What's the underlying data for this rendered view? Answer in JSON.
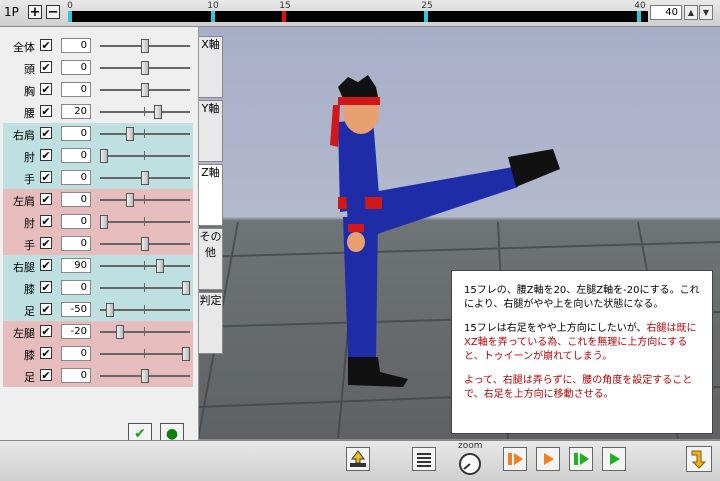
{
  "topbar": {
    "player_label": "1P",
    "plus_label": "+",
    "minus_label": "−",
    "tick_labels": [
      "0",
      "10",
      "15",
      "25",
      "40"
    ],
    "frame_value": "40",
    "spin_up": "▲",
    "spin_down": "▼"
  },
  "joints": [
    {
      "label": "全体",
      "value": "0",
      "checked": "✔",
      "group": "none",
      "level": 0.5
    },
    {
      "label": "頭",
      "value": "0",
      "checked": "✔",
      "group": "none",
      "level": 0.5
    },
    {
      "label": "胸",
      "value": "0",
      "checked": "✔",
      "group": "none",
      "level": 0.5
    },
    {
      "label": "腰",
      "value": "20",
      "checked": "✔",
      "group": "none",
      "level": 0.66
    },
    {
      "label": "右肩",
      "value": "0",
      "checked": "✔",
      "group": "blue",
      "level": 0.32
    },
    {
      "label": "肘",
      "value": "0",
      "checked": "✔",
      "group": "blue",
      "level": 0.0
    },
    {
      "label": "手",
      "value": "0",
      "checked": "✔",
      "group": "blue",
      "level": 0.5
    },
    {
      "label": "左肩",
      "value": "0",
      "checked": "✔",
      "group": "red",
      "level": 0.32
    },
    {
      "label": "肘",
      "value": "0",
      "checked": "✔",
      "group": "red",
      "level": 0.0
    },
    {
      "label": "手",
      "value": "0",
      "checked": "✔",
      "group": "red",
      "level": 0.5
    },
    {
      "label": "右腿",
      "value": "90",
      "checked": "✔",
      "group": "blue",
      "level": 0.68
    },
    {
      "label": "膝",
      "value": "0",
      "checked": "✔",
      "group": "blue",
      "level": 1.0
    },
    {
      "label": "足",
      "value": "-50",
      "checked": "✔",
      "group": "blue",
      "level": 0.07
    },
    {
      "label": "左腿",
      "value": "-20",
      "checked": "✔",
      "group": "red",
      "level": 0.2
    },
    {
      "label": "膝",
      "value": "0",
      "checked": "✔",
      "group": "red",
      "level": 1.0
    },
    {
      "label": "足",
      "value": "0",
      "checked": "✔",
      "group": "red",
      "level": 0.5
    }
  ],
  "side_tabs": [
    {
      "label": "X軸"
    },
    {
      "label": "Y軸"
    },
    {
      "label": "Z軸"
    },
    {
      "label": "その他"
    },
    {
      "label": "判定"
    }
  ],
  "panel_buttons": {
    "confirm_glyph": "✔",
    "dot_glyph": "●"
  },
  "info": {
    "p1": "15フレの、腰Z軸を20、左腿Z軸を-20にする。これにより、右腿がやや上を向いた状態になる。",
    "p2_black": "15フレは右足をやや上方向にしたいが、",
    "p2_red": "右腿は既にXZ軸を弄っている為、これを無理に上方向にすると、トゥイーンが崩れてしまう。",
    "p3": "よって、右腿は弄らずに、腰の角度を設定することで、右足を上方向に移動させる。"
  },
  "bottombar": {
    "zoom_label": "zoom"
  },
  "colors": {
    "timeline_marker": "#30c8d8",
    "timeline_current": "#e01010",
    "group_blue": "#bfe0e0",
    "group_red": "#e6bcbc",
    "play_orange": "#f08020",
    "play_green": "#20b020"
  }
}
